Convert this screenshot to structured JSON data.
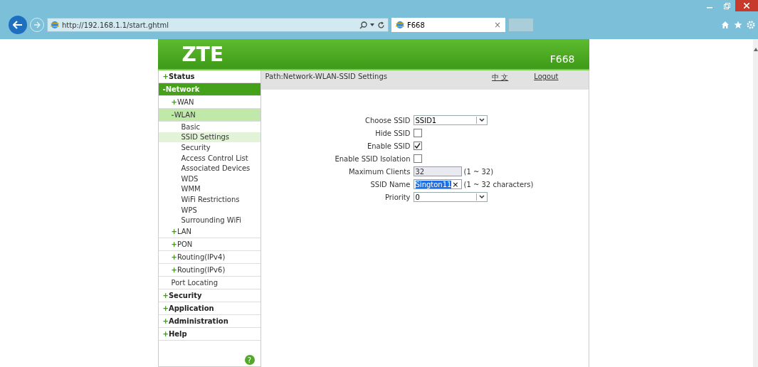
{
  "browser": {
    "address": "http://192.168.1.1/start.ghtml",
    "tab": {
      "title": "F668",
      "close": "×"
    }
  },
  "header": {
    "logo": "ZTE",
    "model": "F668"
  },
  "sidebar": {
    "items": [
      {
        "sign": "+",
        "label": "Status",
        "selected": false
      },
      {
        "sign": "-",
        "label": "Network",
        "selected": true,
        "children": [
          {
            "sign": "+",
            "label": "WAN",
            "selected": false
          },
          {
            "sign": "-",
            "label": "WLAN",
            "selected": true,
            "children": [
              {
                "label": "Basic",
                "selected": false
              },
              {
                "label": "SSID Settings",
                "selected": true
              },
              {
                "label": "Security",
                "selected": false
              },
              {
                "label": "Access Control List",
                "selected": false
              },
              {
                "label": "Associated Devices",
                "selected": false
              },
              {
                "label": "WDS",
                "selected": false
              },
              {
                "label": "WMM",
                "selected": false
              },
              {
                "label": "WiFi Restrictions",
                "selected": false
              },
              {
                "label": "WPS",
                "selected": false
              },
              {
                "label": "Surrounding WiFi",
                "selected": false
              }
            ]
          },
          {
            "sign": "+",
            "label": "LAN",
            "selected": false
          },
          {
            "sign": "+",
            "label": "PON",
            "selected": false
          },
          {
            "sign": "+",
            "label": "Routing(IPv4)",
            "selected": false
          },
          {
            "sign": "+",
            "label": "Routing(IPv6)",
            "selected": false
          },
          {
            "label": "Port Locating",
            "selected": false
          }
        ]
      },
      {
        "sign": "+",
        "label": "Security",
        "selected": false
      },
      {
        "sign": "+",
        "label": "Application",
        "selected": false
      },
      {
        "sign": "+",
        "label": "Administration",
        "selected": false
      },
      {
        "sign": "+",
        "label": "Help",
        "selected": false
      }
    ],
    "help": "?"
  },
  "path_bar": {
    "path": "Path:Network-WLAN-SSID Settings",
    "language": "中 文",
    "logout": "Logout"
  },
  "form": [
    {
      "kind": "select",
      "label": "Choose SSID",
      "value": "SSID1"
    },
    {
      "kind": "checkbox",
      "label": "Hide SSID",
      "checked": false
    },
    {
      "kind": "checkbox",
      "label": "Enable SSID",
      "checked": true
    },
    {
      "kind": "checkbox",
      "label": "Enable SSID Isolation",
      "checked": false
    },
    {
      "kind": "text",
      "label": "Maximum Clients",
      "value": "32",
      "hint": "(1 ~ 32)"
    },
    {
      "kind": "clearable",
      "label": "SSID Name",
      "value": "Sington11",
      "clear": "×",
      "hint": "(1 ~ 32 characters)"
    },
    {
      "kind": "select",
      "label": "Priority",
      "value": "0"
    }
  ]
}
